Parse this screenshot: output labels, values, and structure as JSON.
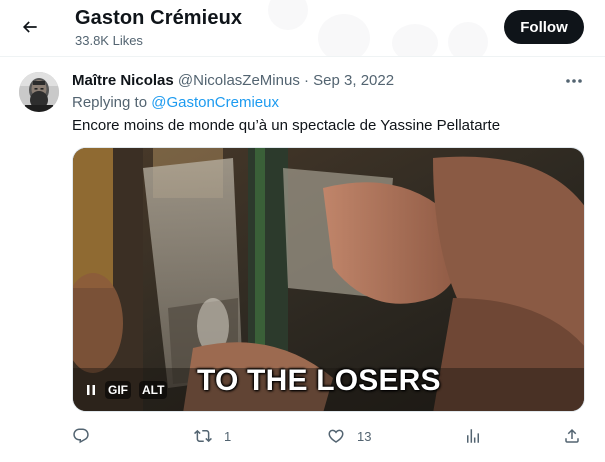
{
  "header": {
    "back_icon": "arrow-left-icon",
    "title": "Gaston Crémieux",
    "subtitle": "33.8K Likes",
    "follow_label": "Follow"
  },
  "tweet": {
    "author_name": "Maître Nicolas",
    "author_handle": "@NicolasZeMinus",
    "separator": "·",
    "date": "Sep 3, 2022",
    "replying_prefix": "Replying to ",
    "replying_to": "@GastonCremieux",
    "text": "Encore moins de monde qu’à un spectacle de Yassine Pellatarte",
    "more_icon": "more-horizontal-icon"
  },
  "media": {
    "caption": "TO THE LOSERS",
    "gif_badge": "GIF",
    "alt_badge": "ALT",
    "pause_icon": "pause-icon"
  },
  "actions": {
    "reply": {
      "icon": "reply-icon",
      "count": ""
    },
    "retweet": {
      "icon": "retweet-icon",
      "count": "1"
    },
    "like": {
      "icon": "heart-icon",
      "count": "13"
    },
    "views": {
      "icon": "analytics-icon",
      "count": ""
    },
    "share": {
      "icon": "share-icon",
      "count": ""
    }
  },
  "colors": {
    "text_primary": "#0f1419",
    "text_secondary": "#536471",
    "link": "#1d9bf0",
    "follow_bg": "#0f1419",
    "follow_text": "#ffffff"
  }
}
